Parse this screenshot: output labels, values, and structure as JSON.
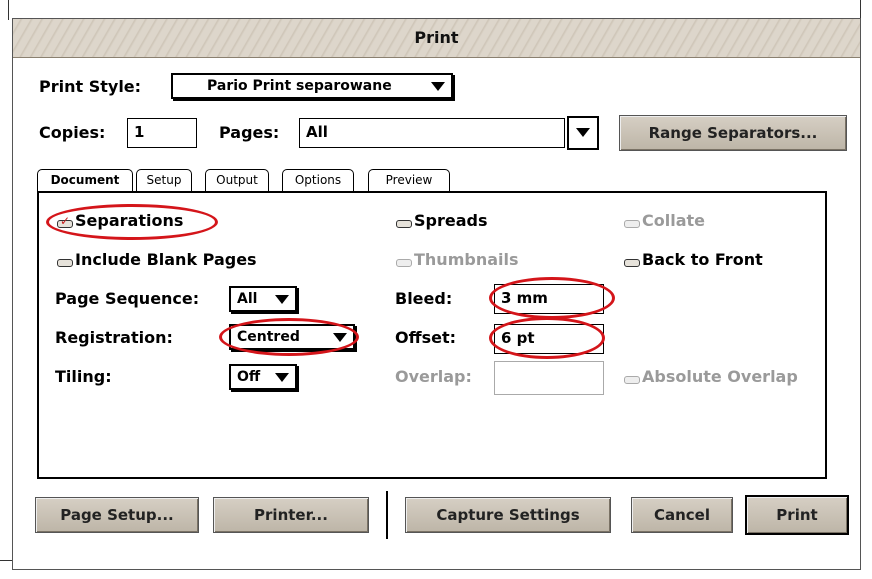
{
  "window": {
    "title": "Print"
  },
  "print_style": {
    "label": "Print Style:",
    "value": "Pario Print separowane"
  },
  "copies": {
    "label": "Copies:",
    "value": "1"
  },
  "pages": {
    "label": "Pages:",
    "value": "All"
  },
  "range_button": "Range Separators...",
  "tabs": [
    "Document",
    "Setup",
    "Output",
    "Options",
    "Preview"
  ],
  "document": {
    "separations": "Separations",
    "spreads": "Spreads",
    "collate": "Collate",
    "include_blank": "Include Blank Pages",
    "thumbnails": "Thumbnails",
    "back_to_front": "Back to Front",
    "page_sequence": {
      "label": "Page Sequence:",
      "value": "All"
    },
    "registration": {
      "label": "Registration:",
      "value": "Centred"
    },
    "tiling": {
      "label": "Tiling:",
      "value": "Off"
    },
    "bleed": {
      "label": "Bleed:",
      "value": "3 mm"
    },
    "offset": {
      "label": "Offset:",
      "value": "6 pt"
    },
    "overlap": {
      "label": "Overlap:",
      "value": ""
    },
    "absolute_overlap": "Absolute Overlap"
  },
  "buttons": {
    "page_setup": "Page Setup...",
    "printer": "Printer...",
    "capture": "Capture Settings",
    "cancel": "Cancel",
    "print": "Print"
  },
  "colors": {
    "annotation": "#d4151a",
    "window_chrome": "#cdc4b6"
  }
}
